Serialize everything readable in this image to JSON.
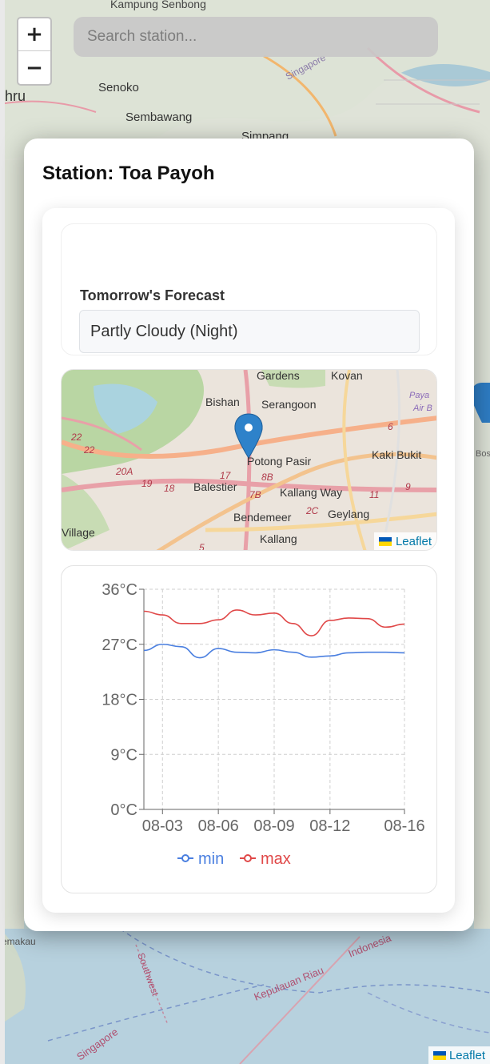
{
  "map": {
    "zoom_in_label": "+",
    "zoom_out_label": "−",
    "attribution": "Leaflet",
    "place_labels": [
      "Kampung Senbong",
      "Senoko",
      "Sembawang",
      "Simpang",
      "Singapore",
      "hru",
      "Kepulauan Riau",
      "Indonesia",
      "Southwest",
      "Singapore",
      "emakau",
      "Bose"
    ]
  },
  "search": {
    "placeholder": "Search station..."
  },
  "modal": {
    "title": "Station: Toa Payoh",
    "forecast_label": "Tomorrow's Forecast",
    "forecast_value": "Partly Cloudy (Night)"
  },
  "mini_map": {
    "attribution": "Leaflet",
    "place_labels": [
      "Gardens",
      "Kovan",
      "Bishan",
      "Serangoon",
      "Potong Pasir",
      "Kaki Bukit",
      "Balestier",
      "Kallang Way",
      "Geylang",
      "Bendemeer",
      "Kallang",
      "Village",
      "Paya",
      "Air B"
    ],
    "road_numbers": [
      "22",
      "22",
      "20A",
      "19",
      "18",
      "17",
      "8B",
      "7B",
      "2C",
      "11",
      "9",
      "6",
      "5"
    ]
  },
  "chart_data": {
    "type": "line",
    "x": [
      "08-02",
      "08-03",
      "08-04",
      "08-05",
      "08-06",
      "08-07",
      "08-08",
      "08-09",
      "08-10",
      "08-11",
      "08-12",
      "08-13",
      "08-14",
      "08-15",
      "08-16"
    ],
    "x_tick_labels": [
      "08-03",
      "08-06",
      "08-09",
      "08-12",
      "08-16"
    ],
    "y_tick_labels": [
      "36°C",
      "27°C",
      "18°C",
      "9°C",
      "0°C"
    ],
    "ylim": [
      0,
      36
    ],
    "grid": true,
    "legend_position": "bottom",
    "series": [
      {
        "name": "min",
        "color": "#4a7fe0",
        "values": [
          26,
          27,
          26.6,
          24.8,
          26.3,
          25.7,
          25.6,
          26.1,
          25.7,
          24.9,
          25.1,
          25.6,
          25.7,
          25.7,
          25.6
        ]
      },
      {
        "name": "max",
        "color": "#e04848",
        "values": [
          32.4,
          31.8,
          30.4,
          30.4,
          31.0,
          32.6,
          31.8,
          32.1,
          30.4,
          28.4,
          30.9,
          31.3,
          31.2,
          29.8,
          30.3
        ]
      }
    ]
  }
}
